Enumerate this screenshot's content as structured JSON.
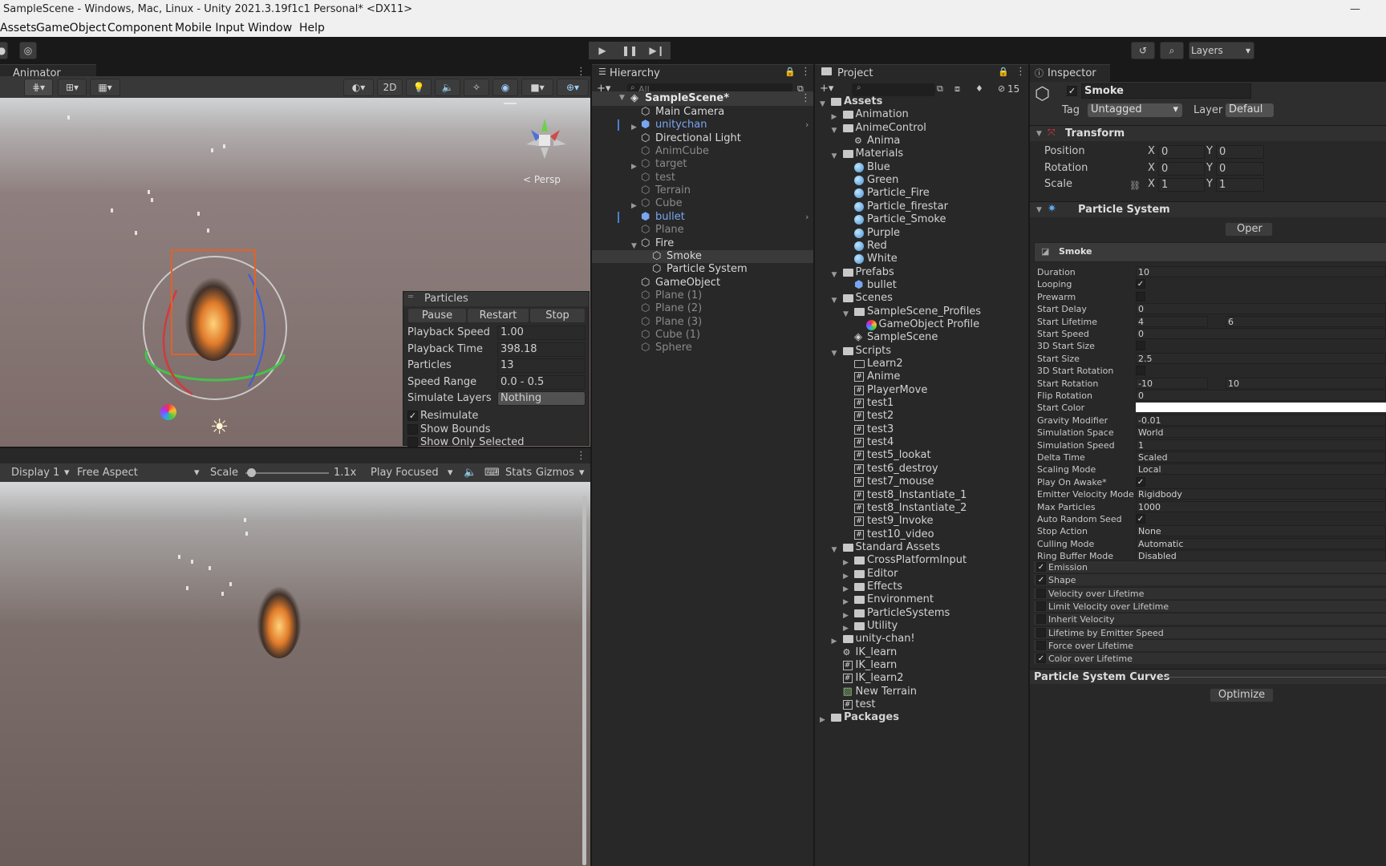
{
  "window_title": "SampleScene - Windows, Mac, Linux - Unity 2021.3.19f1c1 Personal* <DX11>",
  "menu": [
    "Assets",
    "GameObject",
    "Component",
    "Mobile Input",
    "Window",
    "Help"
  ],
  "toolbar": {
    "layers_label": "Layers"
  },
  "animator_tab": "Animator",
  "scene_toolbar": {
    "two_d": "2D",
    "persp": "< Persp"
  },
  "particles_overlay": {
    "title": "Particles",
    "buttons": [
      "Pause",
      "Restart",
      "Stop"
    ],
    "rows": [
      {
        "label": "Playback Speed",
        "value": "1.00"
      },
      {
        "label": "Playback Time",
        "value": "398.18"
      },
      {
        "label": "Particles",
        "value": "13"
      },
      {
        "label": "Speed Range",
        "value": "0.0 - 0.5"
      },
      {
        "label": "Simulate Layers",
        "value": "Nothing"
      }
    ],
    "checks": [
      {
        "label": "Resimulate",
        "checked": "✓"
      },
      {
        "label": "Show Bounds",
        "checked": ""
      },
      {
        "label": "Show Only Selected",
        "checked": ""
      }
    ]
  },
  "game_toolbar": {
    "display": "Display 1",
    "aspect": "Free Aspect",
    "scale_label": "Scale",
    "scale_value": "1.1x",
    "play_mode": "Play Focused",
    "stats": "Stats",
    "gizmos": "Gizmos"
  },
  "hierarchy": {
    "tab": "Hierarchy",
    "search_placeholder": "All",
    "scene_name": "SampleScene*",
    "items": [
      {
        "label": "Main Camera",
        "indent": 1,
        "dim": false,
        "prefab": false,
        "arrow": ""
      },
      {
        "label": "unitychan",
        "indent": 1,
        "dim": false,
        "prefab": true,
        "arrow": "▶"
      },
      {
        "label": "Directional Light",
        "indent": 1,
        "dim": false,
        "prefab": false,
        "arrow": ""
      },
      {
        "label": "AnimCube",
        "indent": 1,
        "dim": true,
        "prefab": false,
        "arrow": ""
      },
      {
        "label": "target",
        "indent": 1,
        "dim": true,
        "prefab": false,
        "arrow": "▶"
      },
      {
        "label": "test",
        "indent": 1,
        "dim": true,
        "prefab": false,
        "arrow": ""
      },
      {
        "label": "Terrain",
        "indent": 1,
        "dim": true,
        "prefab": false,
        "arrow": ""
      },
      {
        "label": "Cube",
        "indent": 1,
        "dim": true,
        "prefab": false,
        "arrow": "▶"
      },
      {
        "label": "bullet",
        "indent": 1,
        "dim": false,
        "prefab": true,
        "arrow": ""
      },
      {
        "label": "Plane",
        "indent": 1,
        "dim": true,
        "prefab": false,
        "arrow": ""
      },
      {
        "label": "Fire",
        "indent": 1,
        "dim": false,
        "prefab": false,
        "arrow": "▼"
      },
      {
        "label": "Smoke",
        "indent": 2,
        "dim": false,
        "prefab": false,
        "arrow": ""
      },
      {
        "label": "Particle System",
        "indent": 2,
        "dim": false,
        "prefab": false,
        "arrow": ""
      },
      {
        "label": "GameObject",
        "indent": 1,
        "dim": false,
        "prefab": false,
        "arrow": ""
      },
      {
        "label": "Plane (1)",
        "indent": 1,
        "dim": true,
        "prefab": false,
        "arrow": ""
      },
      {
        "label": "Plane (2)",
        "indent": 1,
        "dim": true,
        "prefab": false,
        "arrow": ""
      },
      {
        "label": "Plane (3)",
        "indent": 1,
        "dim": true,
        "prefab": false,
        "arrow": ""
      },
      {
        "label": "Cube (1)",
        "indent": 1,
        "dim": true,
        "prefab": false,
        "arrow": ""
      },
      {
        "label": "Sphere",
        "indent": 1,
        "dim": true,
        "prefab": false,
        "arrow": ""
      }
    ]
  },
  "project": {
    "tab": "Project",
    "hidden_count": "15",
    "items": [
      {
        "label": "Assets",
        "indent": 0,
        "icon": "folder",
        "arrow": "▼",
        "bold": true
      },
      {
        "label": "Animation",
        "indent": 1,
        "icon": "folder",
        "arrow": "▶",
        "bold": false
      },
      {
        "label": "AnimeControl",
        "indent": 1,
        "icon": "folder",
        "arrow": "▼",
        "bold": false
      },
      {
        "label": "Anima",
        "indent": 2,
        "icon": "anim",
        "arrow": "",
        "bold": false
      },
      {
        "label": "Materials",
        "indent": 1,
        "icon": "folder",
        "arrow": "▼",
        "bold": false
      },
      {
        "label": "Blue",
        "indent": 2,
        "icon": "mat",
        "arrow": "",
        "bold": false
      },
      {
        "label": "Green",
        "indent": 2,
        "icon": "mat",
        "arrow": "",
        "bold": false
      },
      {
        "label": "Particle_Fire",
        "indent": 2,
        "icon": "mat",
        "arrow": "",
        "bold": false
      },
      {
        "label": "Particle_firestar",
        "indent": 2,
        "icon": "mat",
        "arrow": "",
        "bold": false
      },
      {
        "label": "Particle_Smoke",
        "indent": 2,
        "icon": "mat",
        "arrow": "",
        "bold": false
      },
      {
        "label": "Purple",
        "indent": 2,
        "icon": "mat",
        "arrow": "",
        "bold": false
      },
      {
        "label": "Red",
        "indent": 2,
        "icon": "mat",
        "arrow": "",
        "bold": false
      },
      {
        "label": "White",
        "indent": 2,
        "icon": "mat",
        "arrow": "",
        "bold": false
      },
      {
        "label": "Prefabs",
        "indent": 1,
        "icon": "folder",
        "arrow": "▼",
        "bold": false
      },
      {
        "label": "bullet",
        "indent": 2,
        "icon": "prefab",
        "arrow": "",
        "bold": false
      },
      {
        "label": "Scenes",
        "indent": 1,
        "icon": "folder",
        "arrow": "▼",
        "bold": false
      },
      {
        "label": "SampleScene_Profiles",
        "indent": 2,
        "icon": "folder",
        "arrow": "▼",
        "bold": false
      },
      {
        "label": "GameObject Profile",
        "indent": 3,
        "icon": "profile",
        "arrow": "",
        "bold": false
      },
      {
        "label": "SampleScene",
        "indent": 2,
        "icon": "unity",
        "arrow": "",
        "bold": false
      },
      {
        "label": "Scripts",
        "indent": 1,
        "icon": "folder",
        "arrow": "▼",
        "bold": false
      },
      {
        "label": "Learn2",
        "indent": 2,
        "icon": "folder-empty",
        "arrow": "",
        "bold": false
      },
      {
        "label": "Anime",
        "indent": 2,
        "icon": "script",
        "arrow": "",
        "bold": false
      },
      {
        "label": "PlayerMove",
        "indent": 2,
        "icon": "script",
        "arrow": "",
        "bold": false
      },
      {
        "label": "test1",
        "indent": 2,
        "icon": "script",
        "arrow": "",
        "bold": false
      },
      {
        "label": "test2",
        "indent": 2,
        "icon": "script",
        "arrow": "",
        "bold": false
      },
      {
        "label": "test3",
        "indent": 2,
        "icon": "script",
        "arrow": "",
        "bold": false
      },
      {
        "label": "test4",
        "indent": 2,
        "icon": "script",
        "arrow": "",
        "bold": false
      },
      {
        "label": "test5_lookat",
        "indent": 2,
        "icon": "script",
        "arrow": "",
        "bold": false
      },
      {
        "label": "test6_destroy",
        "indent": 2,
        "icon": "script",
        "arrow": "",
        "bold": false
      },
      {
        "label": "test7_mouse",
        "indent": 2,
        "icon": "script",
        "arrow": "",
        "bold": false
      },
      {
        "label": "test8_Instantiate_1",
        "indent": 2,
        "icon": "script",
        "arrow": "",
        "bold": false
      },
      {
        "label": "test8_Instantiate_2",
        "indent": 2,
        "icon": "script",
        "arrow": "",
        "bold": false
      },
      {
        "label": "test9_Invoke",
        "indent": 2,
        "icon": "script",
        "arrow": "",
        "bold": false
      },
      {
        "label": "test10_video",
        "indent": 2,
        "icon": "script",
        "arrow": "",
        "bold": false
      },
      {
        "label": "Standard Assets",
        "indent": 1,
        "icon": "folder",
        "arrow": "▼",
        "bold": false
      },
      {
        "label": "CrossPlatformInput",
        "indent": 2,
        "icon": "folder",
        "arrow": "▶",
        "bold": false
      },
      {
        "label": "Editor",
        "indent": 2,
        "icon": "folder",
        "arrow": "▶",
        "bold": false
      },
      {
        "label": "Effects",
        "indent": 2,
        "icon": "folder",
        "arrow": "▶",
        "bold": false
      },
      {
        "label": "Environment",
        "indent": 2,
        "icon": "folder",
        "arrow": "▶",
        "bold": false
      },
      {
        "label": "ParticleSystems",
        "indent": 2,
        "icon": "folder",
        "arrow": "▶",
        "bold": false
      },
      {
        "label": "Utility",
        "indent": 2,
        "icon": "folder",
        "arrow": "▶",
        "bold": false
      },
      {
        "label": "unity-chan!",
        "indent": 1,
        "icon": "folder",
        "arrow": "▶",
        "bold": false
      },
      {
        "label": "IK_learn",
        "indent": 1,
        "icon": "anim",
        "arrow": "",
        "bold": false
      },
      {
        "label": "IK_learn",
        "indent": 1,
        "icon": "script",
        "arrow": "",
        "bold": false
      },
      {
        "label": "IK_learn2",
        "indent": 1,
        "icon": "script",
        "arrow": "",
        "bold": false
      },
      {
        "label": "New Terrain",
        "indent": 1,
        "icon": "terrain",
        "arrow": "",
        "bold": false
      },
      {
        "label": "test",
        "indent": 1,
        "icon": "script",
        "arrow": "",
        "bold": false
      },
      {
        "label": "Packages",
        "indent": 0,
        "icon": "folder",
        "arrow": "▶",
        "bold": true
      }
    ]
  },
  "inspector": {
    "tab": "Inspector",
    "object_name": "Smoke",
    "tag_label": "Tag",
    "tag_value": "Untagged",
    "layer_label": "Layer",
    "layer_value": "Defaul",
    "transform_title": "Transform",
    "transform_rows": [
      {
        "label": "Position",
        "x": "0",
        "y": "0"
      },
      {
        "label": "Rotation",
        "x": "0",
        "y": "0"
      },
      {
        "label": "Scale",
        "x": "1",
        "y": "1"
      }
    ],
    "ps_title": "Particle System",
    "open_editor_label": "Oper",
    "ps_name": "Smoke",
    "ps_rows": [
      {
        "label": "Duration",
        "value": "10",
        "value2": "",
        "type": "field"
      },
      {
        "label": "Looping",
        "value": "✓",
        "value2": "",
        "type": "check"
      },
      {
        "label": "Prewarm",
        "value": "",
        "value2": "",
        "type": "check"
      },
      {
        "label": "Start Delay",
        "value": "0",
        "value2": "",
        "type": "field"
      },
      {
        "label": "Start Lifetime",
        "value": "4",
        "value2": "6",
        "type": "pair"
      },
      {
        "label": "Start Speed",
        "value": "0",
        "value2": "",
        "type": "field"
      },
      {
        "label": "3D Start Size",
        "value": "",
        "value2": "",
        "type": "check"
      },
      {
        "label": "Start Size",
        "value": "2.5",
        "value2": "",
        "type": "field"
      },
      {
        "label": "3D Start Rotation",
        "value": "",
        "value2": "",
        "type": "check"
      },
      {
        "label": "Start Rotation",
        "value": "-10",
        "value2": "10",
        "type": "pair"
      },
      {
        "label": "Flip Rotation",
        "value": "0",
        "value2": "",
        "type": "field"
      },
      {
        "label": "Start Color",
        "value": "",
        "value2": "",
        "type": "color"
      },
      {
        "label": "Gravity Modifier",
        "value": "-0.01",
        "value2": "",
        "type": "field"
      },
      {
        "label": "Simulation Space",
        "value": "World",
        "value2": "",
        "type": "field"
      },
      {
        "label": "Simulation Speed",
        "value": "1",
        "value2": "",
        "type": "field"
      },
      {
        "label": "Delta Time",
        "value": "Scaled",
        "value2": "",
        "type": "field"
      },
      {
        "label": "Scaling Mode",
        "value": "Local",
        "value2": "",
        "type": "field"
      },
      {
        "label": "Play On Awake*",
        "value": "✓",
        "value2": "",
        "type": "check"
      },
      {
        "label": "Emitter Velocity Mode",
        "value": "Rigidbody",
        "value2": "",
        "type": "field"
      },
      {
        "label": "Max Particles",
        "value": "1000",
        "value2": "",
        "type": "field"
      },
      {
        "label": "Auto Random Seed",
        "value": "✓",
        "value2": "",
        "type": "check"
      },
      {
        "label": "Stop Action",
        "value": "None",
        "value2": "",
        "type": "field"
      },
      {
        "label": "Culling Mode",
        "value": "Automatic",
        "value2": "",
        "type": "field"
      },
      {
        "label": "Ring Buffer Mode",
        "value": "Disabled",
        "value2": "",
        "type": "field"
      }
    ],
    "modules": [
      {
        "label": "Emission",
        "checked": "✓"
      },
      {
        "label": "Shape",
        "checked": "✓"
      },
      {
        "label": "Velocity over Lifetime",
        "checked": ""
      },
      {
        "label": "Limit Velocity over Lifetime",
        "checked": ""
      },
      {
        "label": "Inherit Velocity",
        "checked": ""
      },
      {
        "label": "Lifetime by Emitter Speed",
        "checked": ""
      },
      {
        "label": "Force over Lifetime",
        "checked": ""
      },
      {
        "label": "Color over Lifetime",
        "checked": "✓"
      }
    ],
    "curves_title": "Particle System Curves",
    "optimize_label": "Optimize"
  },
  "colors": {
    "accent_blue": "#4b7fd1",
    "prefab_blue": "#7aa6f0",
    "selection": "#3a3a3a"
  }
}
